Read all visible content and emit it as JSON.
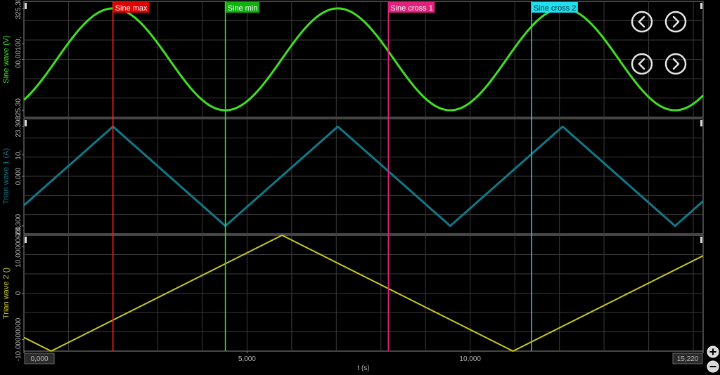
{
  "colors": {
    "background": "#000000",
    "grid": "#3a3a3a",
    "frame": "#8a8a8a",
    "tick_text": "#b8b8b8"
  },
  "cursors": [
    {
      "label": "Sine max",
      "t": 1.996,
      "color": "#ff2020",
      "label_bg": "#e00000",
      "label_fg": "#ffffff"
    },
    {
      "label": "Sine min",
      "t": 4.515,
      "color": "#30e030",
      "label_bg": "#10b010",
      "label_fg": "#ffffff"
    },
    {
      "label": "Sine cross 1",
      "t": 8.166,
      "color": "#e0207a",
      "label_bg": "#e0207a",
      "label_fg": "#ffffff"
    },
    {
      "label": "Sine cross 2",
      "t": 11.373,
      "color": "#20d0e0",
      "label_bg": "#20e0f0",
      "label_fg": "#003030"
    }
  ],
  "nav_buttons": [
    {
      "name": "nav-left-1-button",
      "icon": "chevron-left-icon",
      "symbol": "<"
    },
    {
      "name": "nav-right-1-button",
      "icon": "chevron-right-icon",
      "symbol": ">"
    },
    {
      "name": "nav-left-2-button",
      "icon": "chevron-left-icon",
      "symbol": "<"
    },
    {
      "name": "nav-right-2-button",
      "icon": "chevron-right-icon",
      "symbol": ">"
    }
  ],
  "zoom": {
    "in_icon": "zoom-in-icon",
    "out_icon": "zoom-out-icon"
  },
  "chart_data": [
    {
      "type": "line",
      "title": "",
      "xlabel": "t (s)",
      "ylabel": "Sine wave (V)",
      "color": "#40e020",
      "xlim": [
        0,
        15.22
      ],
      "ylim": [
        -370,
        370
      ],
      "ytick_labels": [
        {
          "text": "325,30",
          "value": 325.3
        },
        {
          "text": "100,",
          "value": 100
        },
        {
          "text": "00,00",
          "value": 0
        },
        {
          "text": "-325,30",
          "value": -325.3
        }
      ],
      "series": [
        {
          "function": "sine",
          "amplitude": 325.3,
          "period": 5.038,
          "phase_t0": 0.737,
          "offset": 0
        }
      ]
    },
    {
      "type": "line",
      "title": "",
      "xlabel": "t (s)",
      "ylabel": "Trian wave 1 (A)",
      "color": "#107888",
      "xlim": [
        0,
        15.22
      ],
      "ylim": [
        -27,
        27
      ],
      "ytick_labels": [
        {
          "text": "23,300",
          "value": 23.3
        },
        {
          "text": "10,",
          "value": 10
        },
        {
          "text": "0,000",
          "value": 0
        },
        {
          "text": "-23,300",
          "value": -23.3
        }
      ],
      "series": [
        {
          "function": "triangle",
          "amplitude": 23.3,
          "period": 5.038,
          "peak_t": 1.996,
          "offset": 0
        }
      ]
    },
    {
      "type": "line",
      "title": "",
      "xlabel": "t (s)",
      "ylabel": "Trian wave 2 ()",
      "color": "#c8c820",
      "xlim": [
        0,
        15.22
      ],
      "ylim": [
        -12.5,
        12.5
      ],
      "ytick_labels": [
        {
          "text": "10,00000000",
          "value": 10
        },
        {
          "text": "0",
          "value": 0
        },
        {
          "text": "-10,00000000",
          "value": -10
        }
      ],
      "series": [
        {
          "function": "triangle",
          "amplitude": 12.5,
          "period": 10.35,
          "peak_t": 5.785,
          "offset": 0
        }
      ]
    }
  ],
  "xaxis": {
    "label": "t (s)",
    "ticks": [
      {
        "text": "0,000",
        "value": 0,
        "boxed": true
      },
      {
        "text": "5,000",
        "value": 5,
        "boxed": false
      },
      {
        "text": "10,000",
        "value": 10,
        "boxed": false
      },
      {
        "text": "15,220",
        "value": 15.22,
        "boxed": true
      }
    ]
  }
}
